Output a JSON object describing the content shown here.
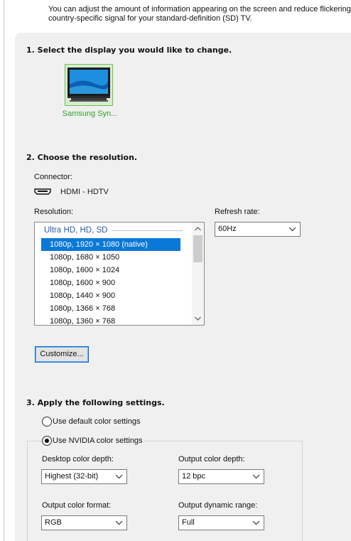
{
  "intro": {
    "line1": "You can adjust the amount of information appearing on the screen and reduce flickering. Y",
    "line2": "country-specific signal for your standard-definition (SD) TV."
  },
  "section1": {
    "title": "1. Select the display you would like to change.",
    "display_name": "Samsung Syn..."
  },
  "section2": {
    "title": "2. Choose the resolution.",
    "connector_label": "Connector:",
    "connector_value": "HDMI - HDTV",
    "resolution_label": "Resolution:",
    "group_label": "Ultra HD, HD, SD",
    "items": [
      "1080p, 1920 × 1080 (native)",
      "1080p, 1680 × 1050",
      "1080p, 1600 × 1024",
      "1080p, 1600 × 900",
      "1080p, 1440 × 900",
      "1080p, 1366 × 768",
      "1080p, 1360 × 768"
    ],
    "selected_index": 0,
    "refresh_label": "Refresh rate:",
    "refresh_value": "60Hz",
    "customize_label": "Customize..."
  },
  "section3": {
    "title": "3. Apply the following settings.",
    "radio_default": "Use default color settings",
    "radio_nvidia": "Use NVIDIA color settings",
    "selected_radio": "nvidia",
    "desktop_depth_label": "Desktop color depth:",
    "desktop_depth_value": "Highest (32-bit)",
    "output_depth_label": "Output color depth:",
    "output_depth_value": "12 bpc",
    "output_format_label": "Output color format:",
    "output_format_value": "RGB",
    "output_range_label": "Output dynamic range:",
    "output_range_value": "Full"
  },
  "colors": {
    "selection": "#0a78d7",
    "display_text": "#30a02a",
    "group_label": "#2a5caa",
    "panel_bg": "#f0f0f0"
  },
  "icons": [
    "monitor-icon",
    "hdmi-connector-icon",
    "chevron-down-icon",
    "scroll-up-arrow-icon",
    "scroll-down-arrow-icon"
  ]
}
